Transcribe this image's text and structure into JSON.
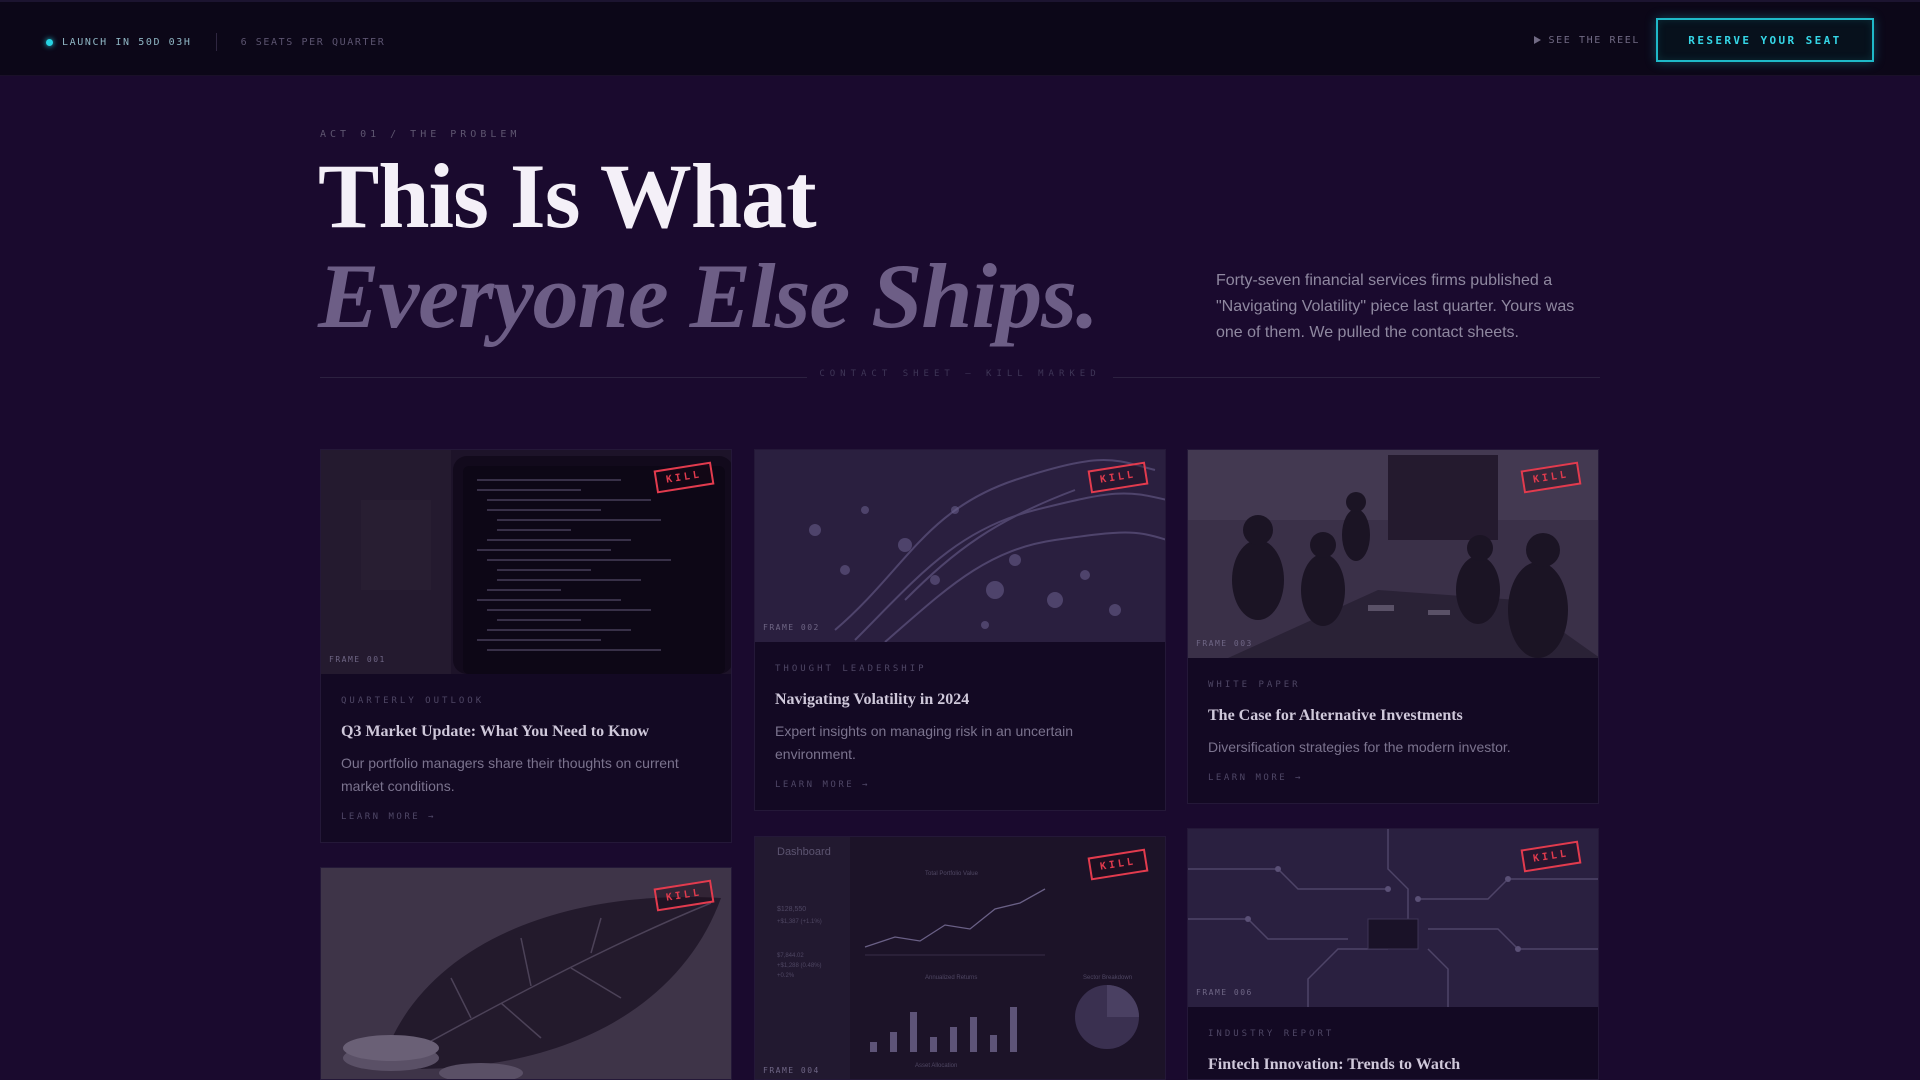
{
  "topbar": {
    "launch": "LAUNCH IN 50D 03H",
    "seats": "6 SEATS PER QUARTER",
    "reel": "SEE THE REEL",
    "reserve": "RESERVE YOUR SEAT"
  },
  "hero": {
    "eyebrow": "ACT 01 / THE PROBLEM",
    "line1": "This Is What",
    "line2": "Everyone Else Ships.",
    "copy": "Forty-seven financial services firms published a \"Navigating Volatility\" piece last quarter. Yours was one of them. We pulled the contact sheets.",
    "divider": "CONTACT SHEET — KILL MARKED"
  },
  "stamp": "KILL",
  "cards": [
    {
      "frame": "FRAME 001",
      "category": "QUARTERLY OUTLOOK",
      "title": "Q3 Market Update: What You Need to Know",
      "description": "Our portfolio managers share their thoughts on current market conditions.",
      "link": "LEARN MORE →"
    },
    {
      "frame": "FRAME 002",
      "category": "THOUGHT LEADERSHIP",
      "title": "Navigating Volatility in 2024",
      "description": "Expert insights on managing risk in an uncertain environment.",
      "link": "LEARN MORE →"
    },
    {
      "frame": "FRAME 003",
      "category": "WHITE PAPER",
      "title": "The Case for Alternative Investments",
      "description": "Diversification strategies for the modern investor.",
      "link": "LEARN MORE →"
    },
    {
      "frame": "FRAME 004",
      "category": "",
      "title": "",
      "description": "",
      "link": ""
    },
    {
      "frame": "FRAME 004",
      "category": "",
      "title": "",
      "description": "",
      "link": "",
      "image_text": {
        "dashboard": "Dashboard",
        "chart1_title": "Total Portfolio Value",
        "chart2_title": "Annualized Returns",
        "chart3_title": "Sector Breakdown",
        "chart4_title": "Asset Allocation",
        "value1": "$128,550",
        "value2": "+$1,387 (+1.1%)",
        "value3": "$7,844.02",
        "value4": "+$1,288 (0.48%)",
        "value5": "+0.2%"
      }
    },
    {
      "frame": "FRAME 006",
      "category": "INDUSTRY REPORT",
      "title": "Fintech Innovation: Trends to Watch",
      "description": "",
      "link": ""
    }
  ],
  "colors": {
    "background": "#1a0a2e",
    "accent": "#27d3e3",
    "stamp": "#e23b4e",
    "card": "#130923"
  }
}
